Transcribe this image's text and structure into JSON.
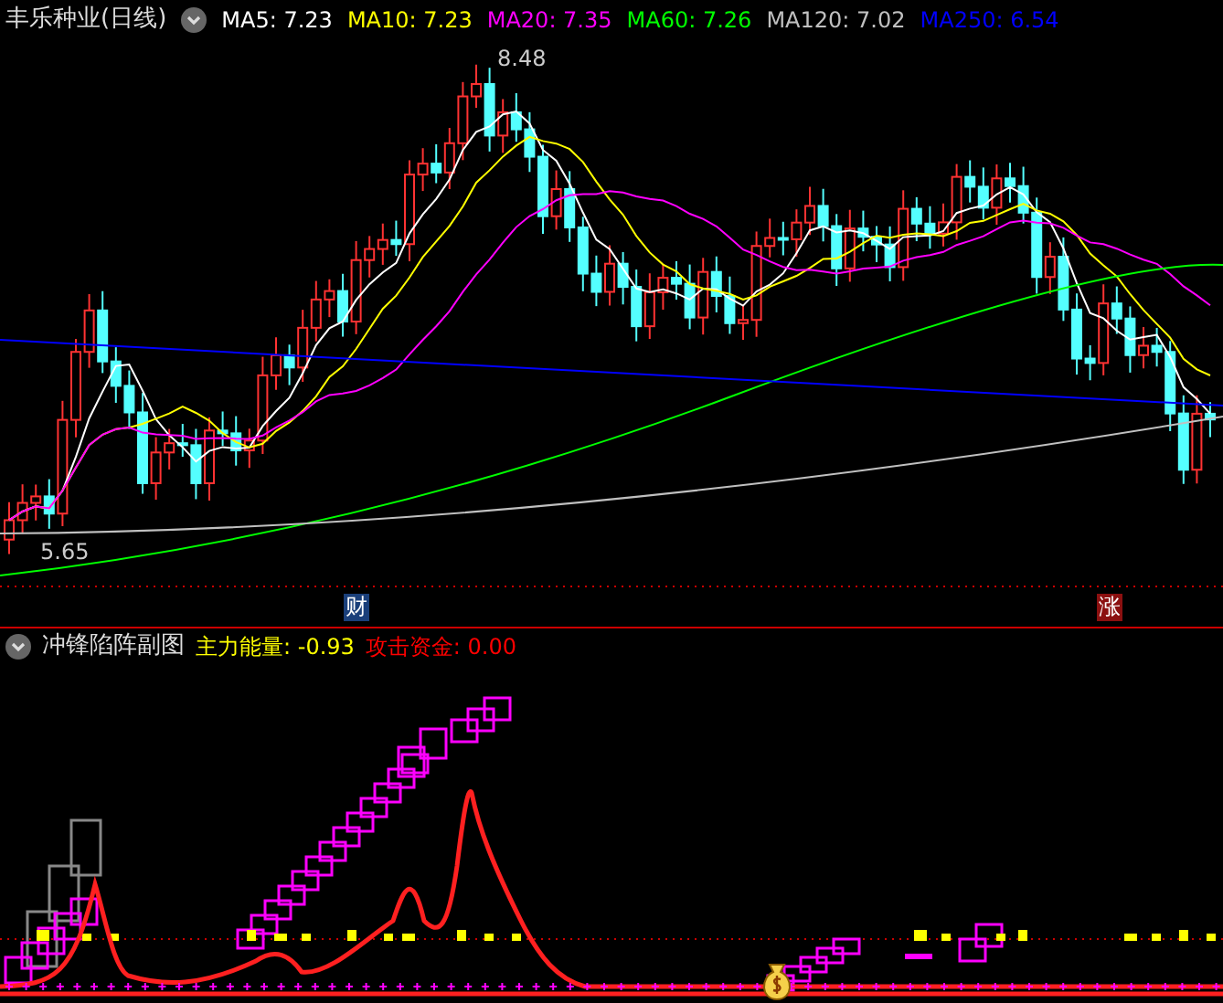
{
  "main_panel": {
    "title": "丰乐种业(日线)",
    "indicators": [
      {
        "label": "MA5: 7.23",
        "color": "#ffffff"
      },
      {
        "label": "MA10: 7.23",
        "color": "#ffff00"
      },
      {
        "label": "MA20: 7.35",
        "color": "#ff00ff"
      },
      {
        "label": "MA60: 7.26",
        "color": "#00ff00"
      },
      {
        "label": "MA120: 7.02",
        "color": "#c0c0c0"
      },
      {
        "label": "MA250: 6.54",
        "color": "#0000ff"
      }
    ],
    "high_label": "8.48",
    "low_label": "5.65",
    "markers": [
      {
        "text": "财",
        "color": "#1a3f7a"
      },
      {
        "text": "涨",
        "color": "#8b1010"
      }
    ]
  },
  "sub_panel": {
    "title": "冲锋陷阵副图",
    "readings": [
      {
        "label": "主力能量: -0.93",
        "color": "#ffff00"
      },
      {
        "label": "攻击资金: 0.00",
        "color": "#ff0000"
      }
    ]
  }
}
